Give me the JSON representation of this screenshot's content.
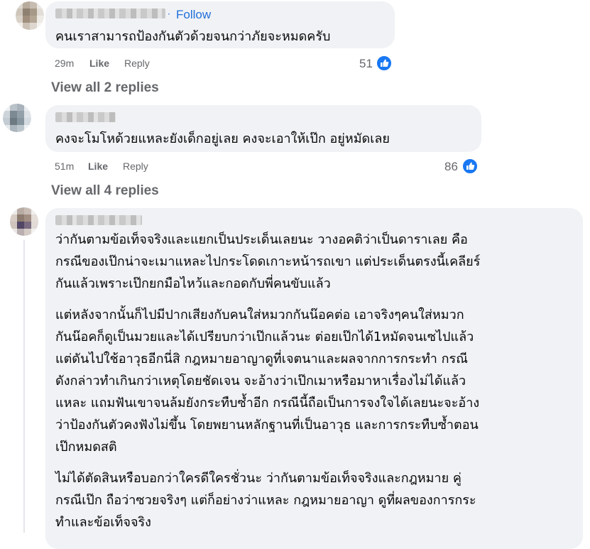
{
  "comments": [
    {
      "follow_label": "Follow",
      "follow_dot": "·",
      "text": "คนเราสามารถป้องกันตัวด้วยจนกว่าภัยจะหมดครับ",
      "time": "29m",
      "like_label": "Like",
      "reply_label": "Reply",
      "reaction_count": "51",
      "view_replies": "View all 2 replies"
    },
    {
      "text": "คงจะโมโหด้วยแหละยังเด็กอยู่เลย คงจะเอาให้เป๊ก อยู่หมัดเลย",
      "time": "51m",
      "like_label": "Like",
      "reply_label": "Reply",
      "reaction_count": "86",
      "view_replies": "View all 4 replies"
    },
    {
      "paragraphs": [
        [
          "ว่ากันตามข้อเท็จจริงและแยกเป็นประเด็นเลยนะ วางอคติว่าเป็นดาราเลย คือ",
          "กรณีของเป๊กน่าจะเมาแหละไปกระโดดเกาะหน้ารถเขา แต่ประเด็นตรงนี้เคลียร์",
          "กันแล้วเพราะเป๊กยกมือไหว้และกอดกับพี่คนขับแล้ว"
        ],
        [
          "แต่หลังจากนั้นก็ไปมีปากเสียงกับคนใส่หมวกกันน๊อคต่อ เอาจริงๆคนใส่หมวก",
          "กันน๊อคก็ดูเป็นมวยและได้เปรียบกว่าเป๊กแล้วนะ ต่อยเป๊กได้1หมัดจนเซไปแล้ว",
          "แต่ดันไปใช้อาวุธอีกนี่สิ กฎหมายอาญาดูที่เจตนาและผลจากการกระทำ กรณี",
          "ดังกล่าวทำเกินกว่าเหตุโดยชัดเจน จะอ้างว่าเป๊กเมาหรือมาหาเรื่องไม่ได้แล้ว",
          "แหละ แถมฟันเขาจนล้มยังกระทืบซ้ำอีก กรณีนี้ถือเป็นการจงใจได้เลยนะจะอ้าง",
          "ว่าป้องกันตัวคงฟังไม่ขึ้น โดยพยานหลักฐานที่เป็นอาวุธ และการกระทืบซ้ำตอน",
          "เป๊กหมดสติ"
        ],
        [
          "ไม่ได้ตัดสินหรือบอกว่าใครดีใครชั่วนะ ว่ากันตามข้อเท็จจริงและกฎหมาย คู่",
          "กรณีเป๊ก ถือว่าซวยจริงๆ แต่ก็อย่างว่าแหละ กฎหมายอาญา ดูที่ผลของการกระ",
          "ทำและข้อเท็จจริง"
        ]
      ]
    }
  ]
}
